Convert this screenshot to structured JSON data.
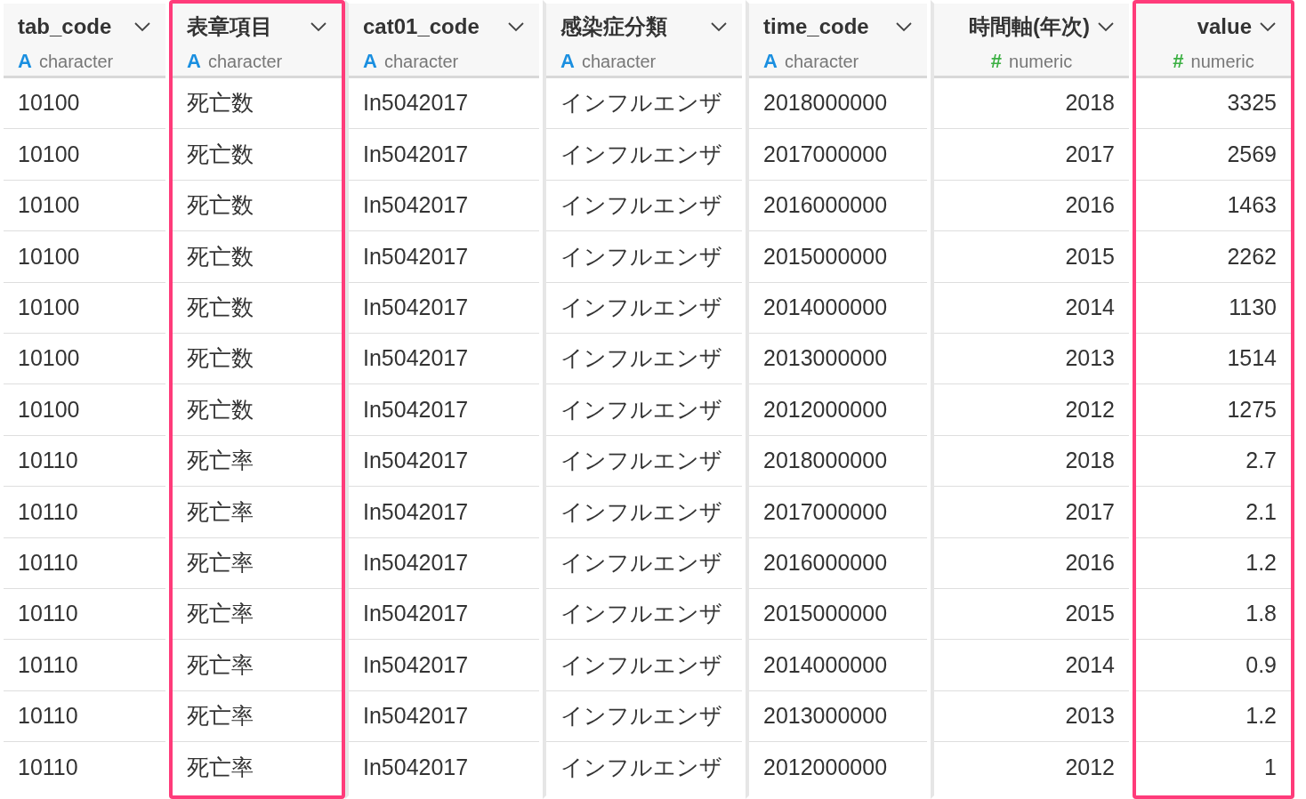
{
  "columns": [
    {
      "name": "tab_code",
      "type": "character",
      "type_icon": "A",
      "kind": "character",
      "highlighted": false
    },
    {
      "name": "表章項目",
      "type": "character",
      "type_icon": "A",
      "kind": "character",
      "highlighted": true
    },
    {
      "name": "cat01_code",
      "type": "character",
      "type_icon": "A",
      "kind": "character",
      "highlighted": false
    },
    {
      "name": "感染症分類",
      "type": "character",
      "type_icon": "A",
      "kind": "character",
      "highlighted": false
    },
    {
      "name": "time_code",
      "type": "character",
      "type_icon": "A",
      "kind": "character",
      "highlighted": false
    },
    {
      "name": "時間軸(年次)",
      "type": "numeric",
      "type_icon": "#",
      "kind": "numeric",
      "highlighted": false
    },
    {
      "name": "value",
      "type": "numeric",
      "type_icon": "#",
      "kind": "numeric",
      "highlighted": true
    }
  ],
  "rows": [
    [
      "10100",
      "死亡数",
      "In5042017",
      "インフルエンザ",
      "2018000000",
      "2018",
      "3325"
    ],
    [
      "10100",
      "死亡数",
      "In5042017",
      "インフルエンザ",
      "2017000000",
      "2017",
      "2569"
    ],
    [
      "10100",
      "死亡数",
      "In5042017",
      "インフルエンザ",
      "2016000000",
      "2016",
      "1463"
    ],
    [
      "10100",
      "死亡数",
      "In5042017",
      "インフルエンザ",
      "2015000000",
      "2015",
      "2262"
    ],
    [
      "10100",
      "死亡数",
      "In5042017",
      "インフルエンザ",
      "2014000000",
      "2014",
      "1130"
    ],
    [
      "10100",
      "死亡数",
      "In5042017",
      "インフルエンザ",
      "2013000000",
      "2013",
      "1514"
    ],
    [
      "10100",
      "死亡数",
      "In5042017",
      "インフルエンザ",
      "2012000000",
      "2012",
      "1275"
    ],
    [
      "10110",
      "死亡率",
      "In5042017",
      "インフルエンザ",
      "2018000000",
      "2018",
      "2.7"
    ],
    [
      "10110",
      "死亡率",
      "In5042017",
      "インフルエンザ",
      "2017000000",
      "2017",
      "2.1"
    ],
    [
      "10110",
      "死亡率",
      "In5042017",
      "インフルエンザ",
      "2016000000",
      "2016",
      "1.2"
    ],
    [
      "10110",
      "死亡率",
      "In5042017",
      "インフルエンザ",
      "2015000000",
      "2015",
      "1.8"
    ],
    [
      "10110",
      "死亡率",
      "In5042017",
      "インフルエンザ",
      "2014000000",
      "2014",
      "0.9"
    ],
    [
      "10110",
      "死亡率",
      "In5042017",
      "インフルエンザ",
      "2013000000",
      "2013",
      "1.2"
    ],
    [
      "10110",
      "死亡率",
      "In5042017",
      "インフルエンザ",
      "2012000000",
      "2012",
      "1"
    ]
  ]
}
